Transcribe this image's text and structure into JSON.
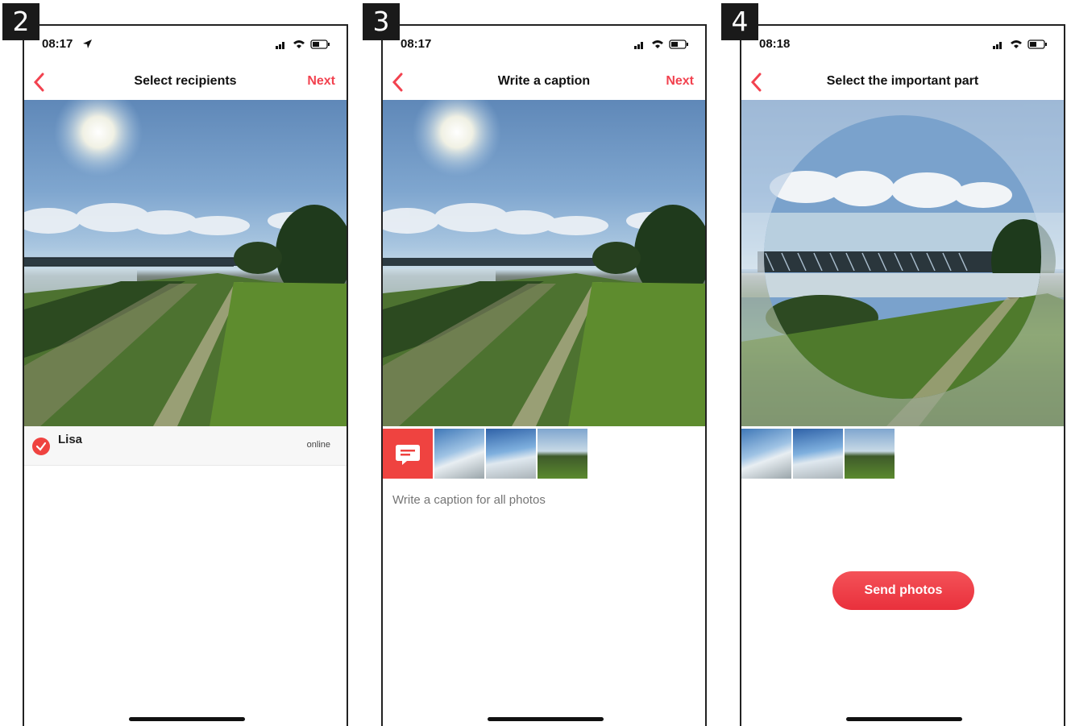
{
  "colors": {
    "accent": "#f2424f",
    "badge_bg": "#1a1a1a"
  },
  "steps": [
    {
      "badge": "2",
      "status_time": "08:17",
      "title": "Select recipients",
      "next_label": "Next",
      "recipient": {
        "name": "Lisa",
        "status": "online"
      }
    },
    {
      "badge": "3",
      "status_time": "08:17",
      "title": "Write a caption",
      "next_label": "Next",
      "caption_placeholder": "Write a caption for all photos"
    },
    {
      "badge": "4",
      "status_time": "08:18",
      "title": "Select the important part",
      "send_label": "Send photos"
    }
  ],
  "icons": [
    "back-chevron-icon",
    "location-arrow-icon",
    "signal-icon",
    "wifi-icon",
    "battery-icon",
    "speech-bubble-icon",
    "checkmark-icon"
  ]
}
